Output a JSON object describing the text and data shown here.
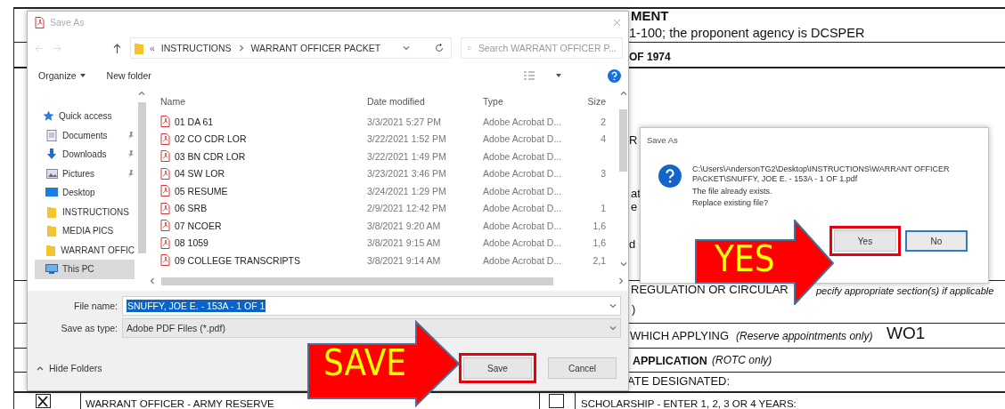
{
  "form": {
    "fragments": [
      {
        "text": "MENT",
        "kind": "bold"
      },
      {
        "text": "1-100; the proponent agency is DCSPER",
        "kind": "plain"
      },
      {
        "text": "OF 1974",
        "kind": "bold"
      },
      {
        "text": "R",
        "kind": "plain"
      },
      {
        "text": "at",
        "kind": "plain"
      },
      {
        "text": "e",
        "kind": "plain"
      },
      {
        "text": "d",
        "kind": "plain"
      },
      {
        "text": "REGULATION OR CIRCULAR",
        "kind": "plain"
      },
      {
        "text": "pecify appropriate section(s) if applicable",
        "kind": "italic"
      },
      {
        "text": ")",
        "kind": "plain"
      },
      {
        "text": "WHICH APPLYING",
        "kind": "plain"
      },
      {
        "text": "(Reserve appointments only)",
        "kind": "italic"
      },
      {
        "text": "WO1",
        "kind": "typed"
      },
      {
        "text": "APPLICATION",
        "kind": "bold"
      },
      {
        "text": "(ROTC only)",
        "kind": "italic"
      },
      {
        "text": "ATE DESIGNATED:",
        "kind": "plain"
      },
      {
        "text": "WARRANT OFFICER - ARMY RESERVE",
        "kind": "plain"
      },
      {
        "text": "SCHOLARSHIP - ENTER 1, 2, 3 OR 4 YEARS:",
        "kind": "plain"
      }
    ],
    "checkboxes": [
      {
        "checked": true
      },
      {
        "checked": false
      }
    ]
  },
  "save_dialog": {
    "title": "Save As",
    "breadcrumb": [
      "«",
      "INSTRUCTIONS",
      "WARRANT OFFICER PACKET"
    ],
    "search": {
      "placeholder": "Search WARRANT OFFICER P..."
    },
    "toolbar": {
      "organize": "Organize",
      "new_folder": "New folder"
    },
    "nav": [
      {
        "label": "Quick access",
        "kind": "star",
        "pinned": false,
        "selected": false
      },
      {
        "label": "Documents",
        "kind": "documents",
        "pinned": true,
        "selected": false
      },
      {
        "label": "Downloads",
        "kind": "downloads",
        "pinned": true,
        "selected": false
      },
      {
        "label": "Pictures",
        "kind": "pictures",
        "pinned": true,
        "selected": false
      },
      {
        "label": "Desktop",
        "kind": "desktop",
        "pinned": false,
        "selected": false
      },
      {
        "label": "INSTRUCTIONS",
        "kind": "folder",
        "pinned": false,
        "selected": false
      },
      {
        "label": "MEDIA PICS",
        "kind": "folder",
        "pinned": false,
        "selected": false
      },
      {
        "label": "WARRANT OFFIC",
        "kind": "folder",
        "pinned": false,
        "selected": false
      },
      {
        "label": "This PC",
        "kind": "pc",
        "pinned": false,
        "selected": true
      }
    ],
    "columns": [
      "Name",
      "Date modified",
      "Type",
      "Size"
    ],
    "files": [
      {
        "name": "01 DA 61",
        "date": "3/3/2021 5:27 PM",
        "type": "Adobe Acrobat D...",
        "size": "2"
      },
      {
        "name": "02 CO CDR LOR",
        "date": "3/22/2021 1:52 PM",
        "type": "Adobe Acrobat D...",
        "size": "4"
      },
      {
        "name": "03 BN CDR LOR",
        "date": "3/22/2021 1:49 PM",
        "type": "Adobe Acrobat D..."
      },
      {
        "name": "04 SW LOR",
        "date": "3/23/2021 3:46 PM",
        "type": "Adobe Acrobat D...",
        "size": "3"
      },
      {
        "name": "05 RESUME",
        "date": "3/24/2021 1:29 PM",
        "type": "Adobe Acrobat D..."
      },
      {
        "name": "06 SRB",
        "date": "2/9/2021 12:42 PM",
        "type": "Adobe Acrobat D...",
        "size": "1"
      },
      {
        "name": "07 NCOER",
        "date": "3/8/2021 9:20 AM",
        "type": "Adobe Acrobat D...",
        "size": "1,6"
      },
      {
        "name": "08 1059",
        "date": "3/8/2021 9:15 AM",
        "type": "Adobe Acrobat D...",
        "size": "1,6"
      },
      {
        "name": "09 COLLEGE TRANSCRIPTS",
        "date": "3/8/2021 9:14 AM",
        "type": "Adobe Acrobat D...",
        "size": "2,1"
      }
    ],
    "file_name": {
      "label": "File name:",
      "value": "SNUFFY, JOE E. - 153A - 1 OF 1"
    },
    "save_type": {
      "label": "Save as type:",
      "value": "Adobe PDF Files (*.pdf)"
    },
    "hide_folders": "Hide Folders",
    "buttons": [
      {
        "label": "Save",
        "highlighted": true,
        "focused": false
      },
      {
        "label": "Cancel",
        "highlighted": false,
        "focused": false
      }
    ]
  },
  "replace_dialog": {
    "title": "Save As",
    "message": [
      "C:\\Users\\AndersonTG2\\Desktop\\INSTRUCTIONS\\WARRANT OFFICER PACKET\\SNUFFY, JOE E. - 153A - 1 OF 1.pdf",
      "The file already exists.",
      "Replace existing file?"
    ],
    "buttons": [
      {
        "label": "Yes",
        "highlighted": true,
        "focused": false
      },
      {
        "label": "No",
        "highlighted": false,
        "focused": true
      }
    ]
  },
  "callouts": [
    {
      "text": "SAVE"
    },
    {
      "text": "YES"
    }
  ]
}
